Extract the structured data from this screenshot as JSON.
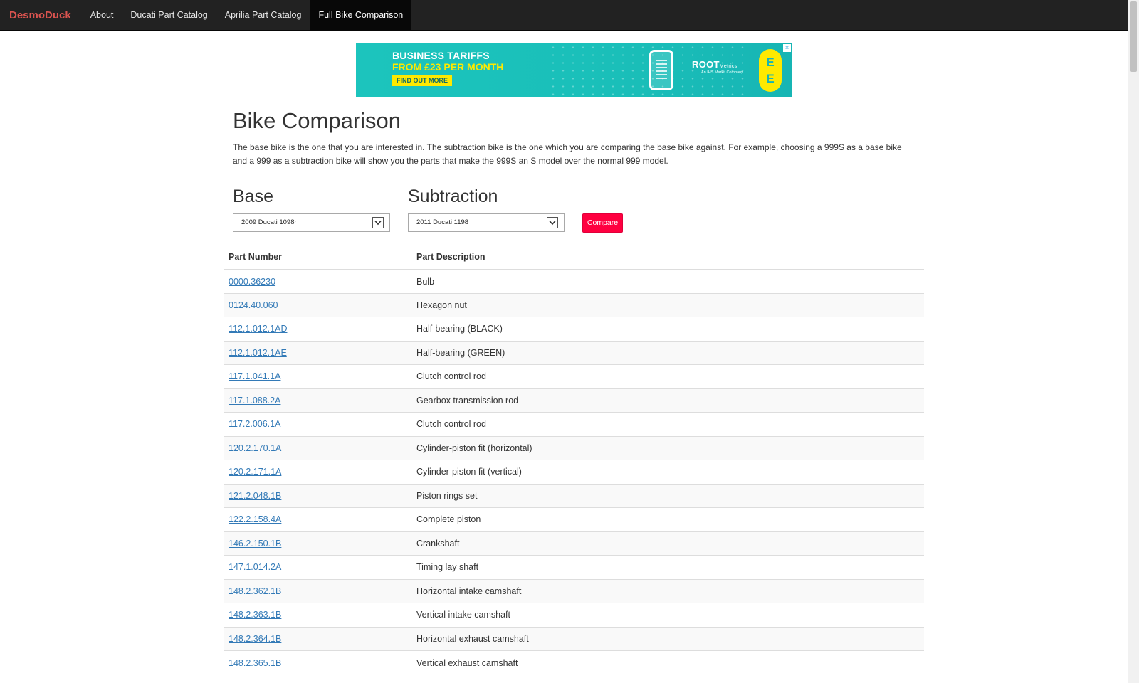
{
  "nav": {
    "brand": "DesmoDuck",
    "items": [
      {
        "label": "About"
      },
      {
        "label": "Ducati Part Catalog"
      },
      {
        "label": "Aprilia Part Catalog"
      },
      {
        "label": "Full Bike Comparison"
      }
    ]
  },
  "ad": {
    "headline": "BUSINESS TARIFFS",
    "sub": "FROM £23 PER MONTH",
    "cta": "FIND OUT MORE",
    "partner": "ROOT",
    "partner_suffix": "Metrics",
    "partner_small": "An IHS Markit Company",
    "brand_letters": [
      "E",
      "E"
    ],
    "close": "×"
  },
  "page": {
    "title": "Bike Comparison",
    "intro": "The base bike is the one that you are interested in. The subtraction bike is the one which you are comparing the base bike against. For example, choosing a 999S as a base bike and a 999 as a subtraction bike will show you the parts that make the 999S an S model over the normal 999 model."
  },
  "form": {
    "base_label": "Base",
    "base_value": "2009 Ducati 1098r",
    "subtraction_label": "Subtraction",
    "subtraction_value": "2011 Ducati 1198",
    "compare_label": "Compare"
  },
  "table": {
    "headers": {
      "number": "Part Number",
      "description": "Part Description"
    },
    "rows": [
      {
        "number": "0000.36230",
        "description": "Bulb"
      },
      {
        "number": "0124.40.060",
        "description": "Hexagon nut"
      },
      {
        "number": "112.1.012.1AD",
        "description": "Half-bearing (BLACK)"
      },
      {
        "number": "112.1.012.1AE",
        "description": "Half-bearing (GREEN)"
      },
      {
        "number": "117.1.041.1A",
        "description": "Clutch control rod"
      },
      {
        "number": "117.1.088.2A",
        "description": "Gearbox transmission rod"
      },
      {
        "number": "117.2.006.1A",
        "description": "Clutch control rod"
      },
      {
        "number": "120.2.170.1A",
        "description": "Cylinder-piston fit (horizontal)"
      },
      {
        "number": "120.2.171.1A",
        "description": "Cylinder-piston fit (vertical)"
      },
      {
        "number": "121.2.048.1B",
        "description": "Piston rings set"
      },
      {
        "number": "122.2.158.4A",
        "description": "Complete piston"
      },
      {
        "number": "146.2.150.1B",
        "description": "Crankshaft"
      },
      {
        "number": "147.1.014.2A",
        "description": "Timing lay shaft"
      },
      {
        "number": "148.2.362.1B",
        "description": "Horizontal intake camshaft"
      },
      {
        "number": "148.2.363.1B",
        "description": "Vertical intake camshaft"
      },
      {
        "number": "148.2.364.1B",
        "description": "Horizontal exhaust camshaft"
      },
      {
        "number": "148.2.365.1B",
        "description": "Vertical exhaust camshaft"
      }
    ]
  },
  "colors": {
    "navbar": "#222222",
    "brand": "#d9534f",
    "link": "#337ab7",
    "compare_button": "#ff0040",
    "ad_background": "#1cc4bd",
    "ad_accent": "#ffe900"
  }
}
